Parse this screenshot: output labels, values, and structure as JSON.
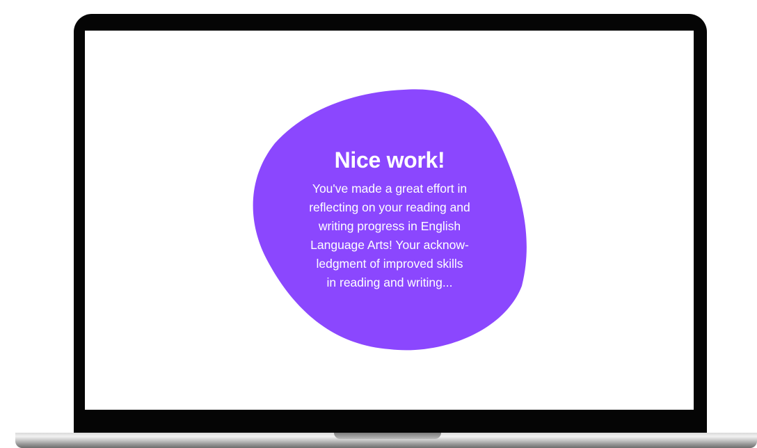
{
  "colors": {
    "bezel": "#050505",
    "screen": "#ffffff",
    "blob_accent": "#8b47fe",
    "text_on_accent": "#ffffff"
  },
  "feedback": {
    "title": "Nice work!",
    "body": "You've made a great effort in\nreflecting on your reading and\nwriting progress in English\nLanguage Arts! Your acknow-\nledgment of improved skills\nin reading and writing..."
  }
}
